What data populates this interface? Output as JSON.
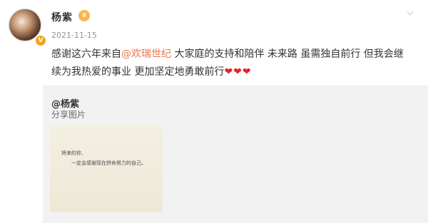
{
  "post": {
    "author": "杨紫",
    "timestamp": "2021-11-15",
    "text_before_mention": "感谢这六年来自",
    "mention": "@欢瑞世纪",
    "text_after_mention": " 大家庭的支持和陪伴 未来路 虽需独自前行 但我会继续为我热爱的事业 更加坚定地勇敢前行",
    "hearts": "❤❤❤"
  },
  "repost": {
    "author": "@杨紫",
    "text": "分享图片",
    "image": {
      "line1": "将来的你,",
      "line2": "一定会感谢现在拼命努力的自己。"
    }
  },
  "icons": {
    "verified": "verified-badge-icon",
    "member": "member-badge-icon",
    "more": "chevron-down-icon"
  },
  "colors": {
    "mention": "#eb7350",
    "heart": "#e0242a",
    "repost_bg": "#f2f2f2",
    "timestamp": "#939393"
  }
}
